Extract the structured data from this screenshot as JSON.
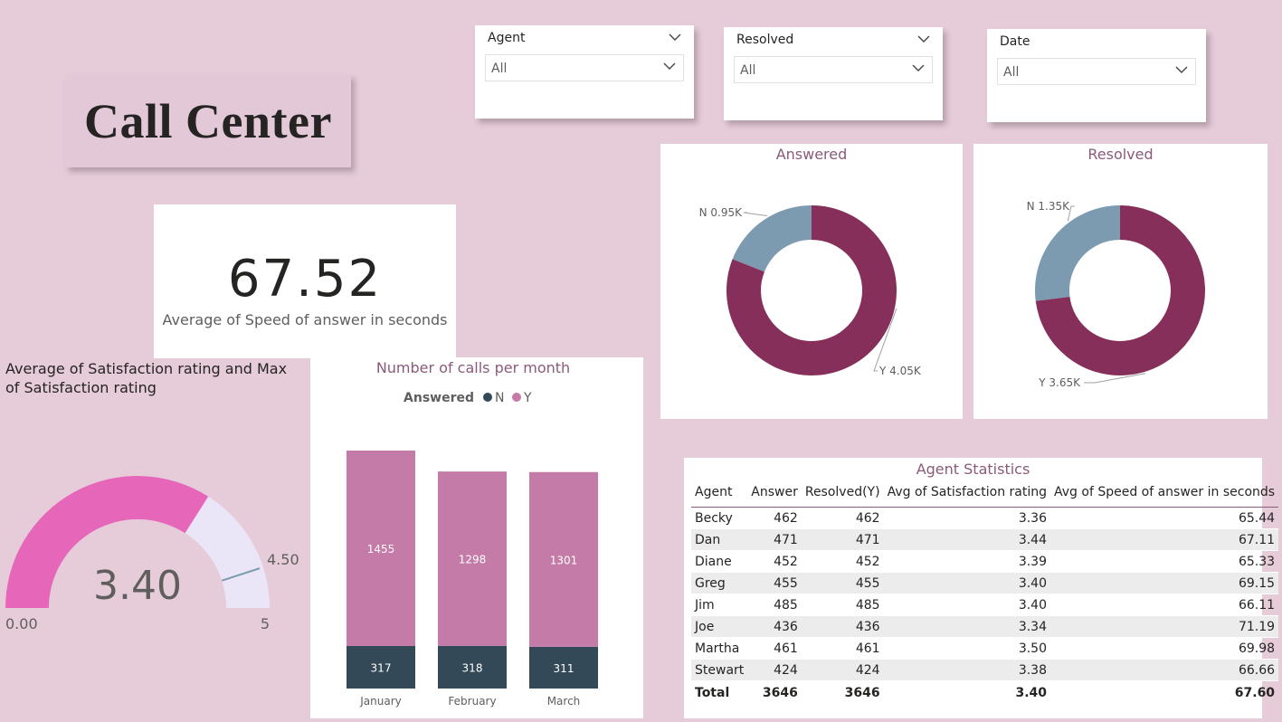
{
  "report_title": "Call Center",
  "slicers": [
    {
      "label": "Agent",
      "value": "All"
    },
    {
      "label": "Resolved",
      "value": "All"
    },
    {
      "label": "Date",
      "value": "All"
    }
  ],
  "kpi": {
    "value": "67.52",
    "label": "Average of Speed of answer in seconds"
  },
  "gauge": {
    "title": "Average of Satisfaction rating and Max of Satisfaction rating",
    "value_label": "3.40",
    "min_label": "0.00",
    "max_label": "5",
    "target_label": "4.50",
    "value": 3.4,
    "min": 0,
    "max": 5,
    "target": 4.5,
    "fill_color": "#e667b9",
    "track_color": "#ebe6f7",
    "target_color": "#7d9bb0"
  },
  "chart_data": [
    {
      "type": "bar",
      "title": "Number of calls per month",
      "legend_title": "Answered",
      "categories": [
        "January",
        "February",
        "March"
      ],
      "series": [
        {
          "name": "N",
          "values": [
            317,
            318,
            311
          ],
          "color": "#344957"
        },
        {
          "name": "Y",
          "values": [
            1455,
            1298,
            1301
          ],
          "color": "#c47ba7"
        }
      ],
      "stacked": true
    },
    {
      "type": "pie",
      "title": "Answered",
      "slices": [
        {
          "label": "N",
          "value": 950,
          "display": "N 0.95K",
          "color": "#7d9bb0"
        },
        {
          "label": "Y",
          "value": 4050,
          "display": "Y 4.05K",
          "color": "#862f5a"
        }
      ]
    },
    {
      "type": "pie",
      "title": "Resolved",
      "slices": [
        {
          "label": "N",
          "value": 1350,
          "display": "N 1.35K",
          "color": "#7d9bb0"
        },
        {
          "label": "Y",
          "value": 3650,
          "display": "Y 3.65K",
          "color": "#862f5a"
        }
      ]
    }
  ],
  "agent_table": {
    "title": "Agent Statistics",
    "columns": [
      "Agent",
      "Answer",
      "Resolved(Y)",
      "Avg of Satisfaction rating",
      "Avg of Speed of answer in seconds"
    ],
    "rows": [
      [
        "Becky",
        "462",
        "462",
        "3.36",
        "65.44"
      ],
      [
        "Dan",
        "471",
        "471",
        "3.44",
        "67.11"
      ],
      [
        "Diane",
        "452",
        "452",
        "3.39",
        "65.33"
      ],
      [
        "Greg",
        "455",
        "455",
        "3.40",
        "69.15"
      ],
      [
        "Jim",
        "485",
        "485",
        "3.40",
        "66.11"
      ],
      [
        "Joe",
        "436",
        "436",
        "3.34",
        "71.19"
      ],
      [
        "Martha",
        "461",
        "461",
        "3.50",
        "69.98"
      ],
      [
        "Stewart",
        "424",
        "424",
        "3.38",
        "66.66"
      ]
    ],
    "total": [
      "Total",
      "3646",
      "3646",
      "3.40",
      "67.60"
    ]
  },
  "colors": {
    "page_bg": "#e6cbd9",
    "title_bg": "#e3c9d7",
    "accent_text": "#8a5a7a"
  }
}
